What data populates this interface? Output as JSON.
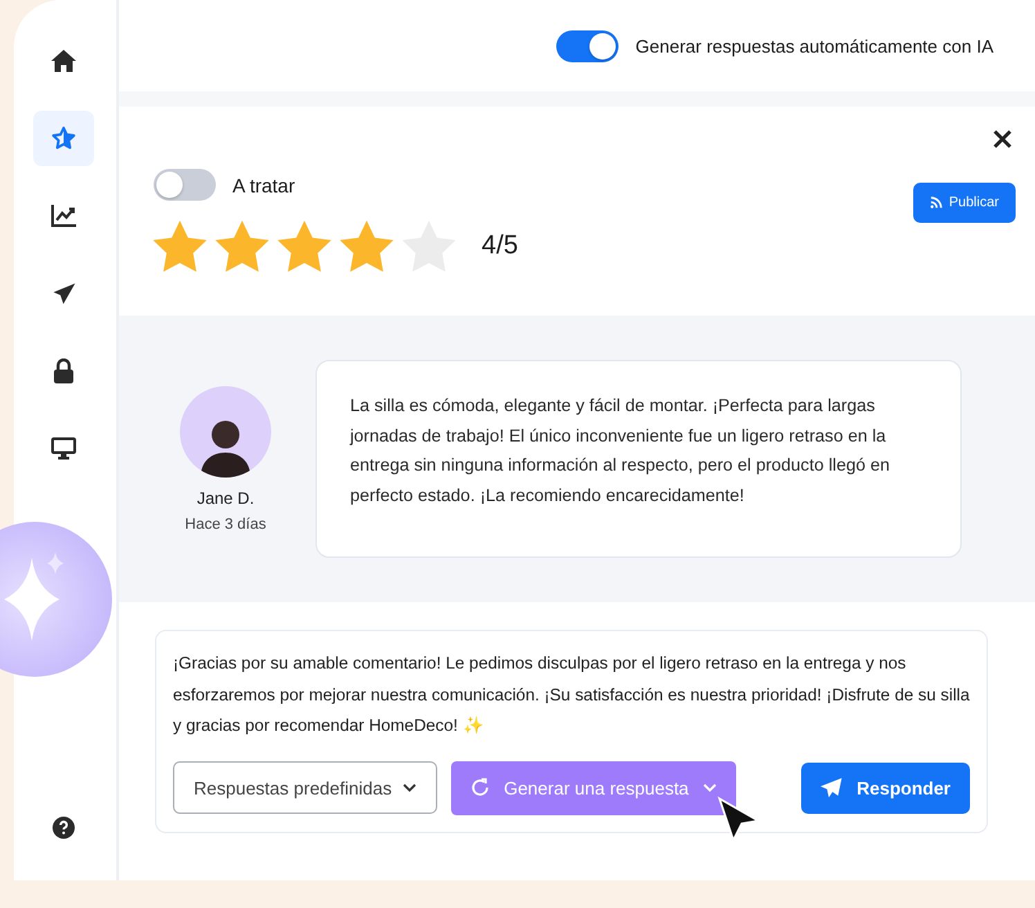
{
  "sidebar": {
    "items": [
      {
        "selected": false
      },
      {
        "selected": true
      },
      {
        "selected": false
      },
      {
        "selected": false
      },
      {
        "selected": false
      },
      {
        "selected": false
      }
    ]
  },
  "top_bar": {
    "auto_reply_toggle": {
      "label": "Generar respuestas automáticamente con IA",
      "on": true
    }
  },
  "review_header": {
    "status_toggle": {
      "label": "A tratar",
      "on": false
    },
    "stars": 4,
    "rating": "4/5",
    "publish_button": "Publicar"
  },
  "review": {
    "author": "Jane D.",
    "time": "Hace 3 días",
    "text": "La silla es cómoda, elegante y fácil de montar. ¡Perfecta para largas jornadas de trabajo! El único inconveniente fue un ligero retraso en la entrega sin ninguna información al respecto, pero el producto llegó en perfecto estado. ¡La recomiendo encarecidamente!"
  },
  "reply": {
    "text": "¡Gracias por su amable comentario! Le pedimos disculpas por el ligero retraso en la entrega y nos esforzaremos por mejorar nuestra comunicación. ¡Su satisfacción es nuestra prioridad! ¡Disfrute de su silla y gracias por recomendar HomeDeco! ✨",
    "predefined_dropdown": "Respuestas predefinidas",
    "generate_button": "Generar una respuesta",
    "send_button": "Responder"
  }
}
